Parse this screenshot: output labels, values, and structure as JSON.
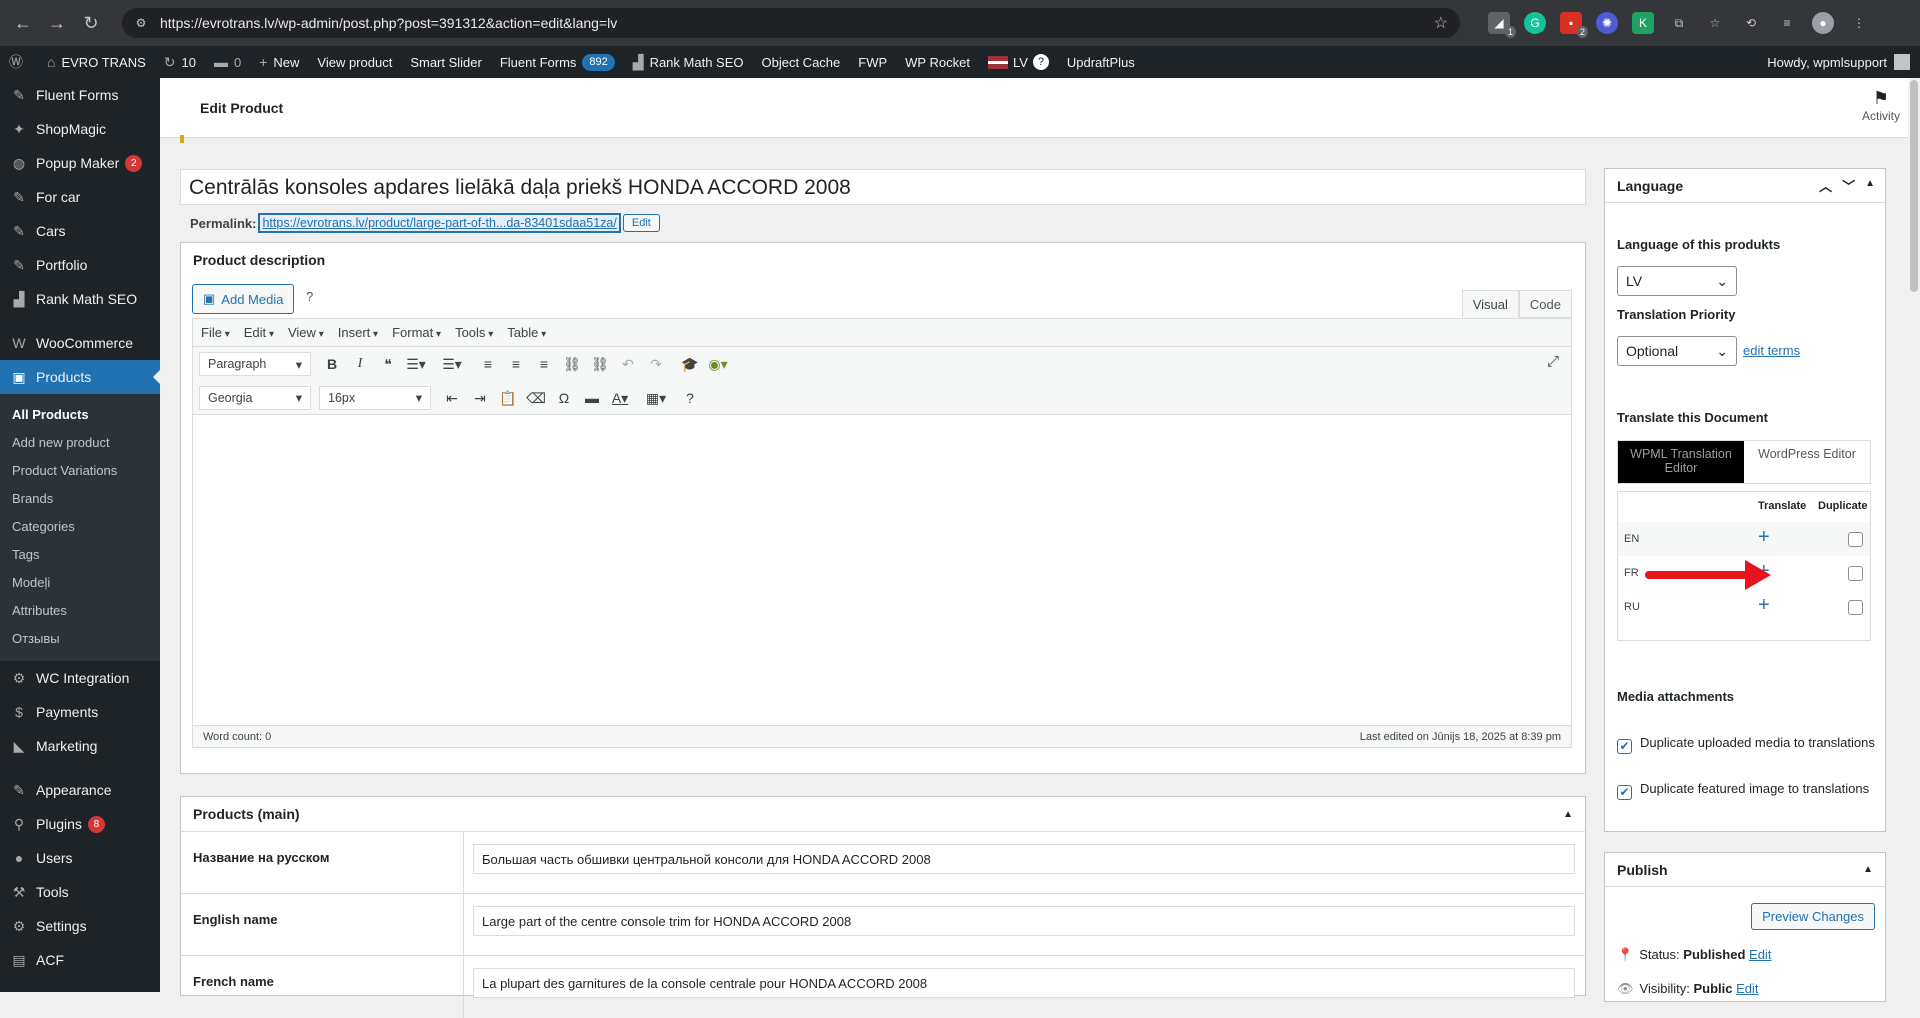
{
  "browser": {
    "url": "https://evrotrans.lv/wp-admin/post.php?post=391312&action=edit&lang=lv",
    "ext_badges": [
      "1",
      "2"
    ]
  },
  "adminbar": {
    "site": "EVRO TRANS",
    "updates": "10",
    "comments": "0",
    "new": "New",
    "view_product": "View product",
    "smart_slider": "Smart Slider",
    "fluent_forms": "Fluent Forms",
    "fluent_count": "892",
    "rank_math": "Rank Math SEO",
    "object_cache": "Object Cache",
    "fwp": "FWP",
    "wp_rocket": "WP Rocket",
    "lang": "LV",
    "lang_q": "?",
    "updraft": "UpdraftPlus",
    "howdy": "Howdy, wpmlsupport"
  },
  "sidebar": {
    "items": [
      {
        "label": "Fluent Forms",
        "icon": "✎"
      },
      {
        "label": "ShopMagic",
        "icon": "✦"
      },
      {
        "label": "Popup Maker",
        "icon": "◍",
        "badge": "2"
      },
      {
        "label": "For car",
        "icon": "✎"
      },
      {
        "label": "Cars",
        "icon": "✎"
      },
      {
        "label": "Portfolio",
        "icon": "✎"
      },
      {
        "label": "Rank Math SEO",
        "icon": "▟"
      },
      {
        "label": "WooCommerce",
        "icon": "W"
      },
      {
        "label": "Products",
        "icon": "▣"
      }
    ],
    "submenu": [
      "All Products",
      "Add new product",
      "Product Variations",
      "Brands",
      "Categories",
      "Tags",
      "Modeļi",
      "Attributes",
      "Отзывы"
    ],
    "items2": [
      {
        "label": "WC Integration",
        "icon": "⚙"
      },
      {
        "label": "Payments",
        "icon": "$"
      },
      {
        "label": "Marketing",
        "icon": "◣"
      },
      {
        "label": "Appearance",
        "icon": "✎"
      },
      {
        "label": "Plugins",
        "icon": "⚲",
        "badge": "8"
      },
      {
        "label": "Users",
        "icon": "●"
      },
      {
        "label": "Tools",
        "icon": "⚒"
      },
      {
        "label": "Settings",
        "icon": "⚙"
      },
      {
        "label": "ACF",
        "icon": "▤"
      }
    ]
  },
  "header": {
    "title": "Edit Product",
    "activity": "Activity"
  },
  "post": {
    "title": "Centrālās konsoles apdares lielākā daļa priekš HONDA ACCORD 2008",
    "permalink_label": "Permalink:",
    "permalink": "https://evrotrans.lv/product/large-part-of-th...da-83401sdaa51za/",
    "edit": "Edit"
  },
  "editor": {
    "box_title": "Product description",
    "add_media": "Add Media",
    "help": "?",
    "tab_visual": "Visual",
    "tab_code": "Code",
    "menus": [
      "File",
      "Edit",
      "View",
      "Insert",
      "Format",
      "Tools",
      "Table"
    ],
    "format": "Paragraph",
    "font": "Georgia",
    "size": "16px",
    "word_count": "Word count: 0",
    "last_edited": "Last edited on Jūnijs 18, 2025 at 8:39 pm"
  },
  "fields": {
    "title": "Products (main)",
    "rows": [
      {
        "label": "Название на русском",
        "value": "Большая часть обшивки центральной консоли для HONDA ACCORD 2008"
      },
      {
        "label": "English name",
        "value": "Large part of the centre console trim for HONDA ACCORD 2008"
      },
      {
        "label": "French name",
        "value": "La plupart des garnitures de la console centrale pour HONDA ACCORD 2008"
      }
    ]
  },
  "language": {
    "title": "Language",
    "lang_label": "Language of this produkts",
    "lang_value": "LV",
    "priority_label": "Translation Priority",
    "priority_value": "Optional",
    "edit_terms": "edit terms",
    "translate_label": "Translate this Document",
    "wpml_editor": "WPML Translation Editor",
    "wp_editor": "WordPress Editor",
    "col_translate": "Translate",
    "col_duplicate": "Duplicate",
    "langs": [
      "EN",
      "FR",
      "RU"
    ],
    "media_title": "Media attachments",
    "dup_media": "Duplicate uploaded media to translations",
    "dup_featured": "Duplicate featured image to translations"
  },
  "publish": {
    "title": "Publish",
    "preview": "Preview Changes",
    "status_label": "Status:",
    "status": "Published",
    "edit": "Edit",
    "visibility_label": "Visibility:",
    "visibility": "Public"
  }
}
